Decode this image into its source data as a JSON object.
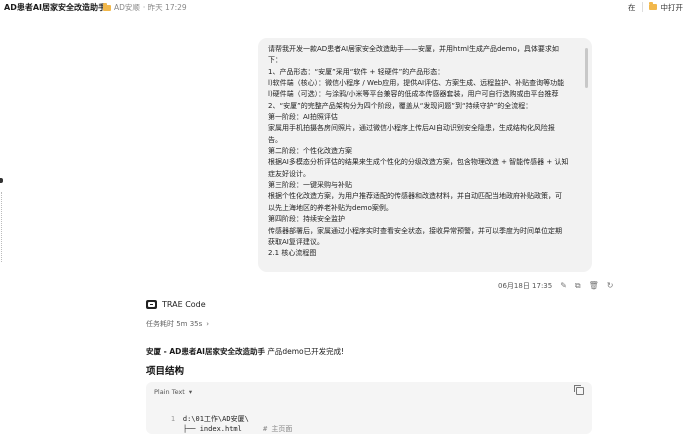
{
  "header": {
    "title": "AD患者AI居家安全改造助手",
    "folder": "AD安顺",
    "time": "· 昨天 17:29",
    "right_label": "在",
    "open_label": "中打开"
  },
  "message": {
    "lines": [
      "请帮我开发一款AD患者AI居家安全改造助手——安厦，并用html生成产品demo，具体要求如",
      "下：",
      "1、产品形态：“安厦”采用“软件 + 轻硬件”的产品形态：",
      "l)软件端（核心）：微信小程序 / Web应用，提供AI评估、方案生成、远程监护、补贴查询等功能",
      "l)硬件端（可选）：与涂鸦/小米等平台兼容的低成本传感器套装，用户可自行选购或由平台推荐",
      "2、“安厦”的完整产品架构分为四个阶段，覆盖从“发现问题”到“持续守护”的全流程：",
      "第一阶段：AI拍照评估",
      "家属用手机拍摄各房间照片，通过微信小程序上传后AI自动识别安全隐患，生成结构化风险报",
      "告。",
      "第二阶段：个性化改造方案",
      "根据AI多模态分析评估的结果来生成个性化的分级改造方案，包含物理改造 + 智能传感器 + 认知",
      "症友好设计。",
      "第三阶段：一键采购与补贴",
      "根据个性化改造方案，为用户推荐适配的传感器和改造材料，并自动匹配当地政府补贴政策，可",
      "以先上海地区的养老补贴为demo案例。",
      "第四阶段：持续安全监护",
      "传感器部署后，家属通过小程序实时查看安全状态，接收异常预警，并可以季度为时间单位定期",
      "获取AI复评建议。",
      "2.1 核心流程图"
    ],
    "timestamp": "06月18日 17:35"
  },
  "agent": {
    "name": "TRAE Code",
    "elapsed": "任务耗时 5m 35s",
    "summary_bold": "安厦 - AD患者AI居家安全改造助手",
    "summary_rest": " 产品demo已开发完成!",
    "section_title": "项目结构"
  },
  "code": {
    "language": "Plain Text",
    "lines": [
      {
        "num": "1",
        "text": "d:\\01工作\\AD安厦\\",
        "comment": ""
      },
      {
        "num": "",
        "text": "├── index.html",
        "comment": "# 主页面"
      }
    ]
  },
  "icons": [
    "folder-icon",
    "chevron-icon",
    "copy-icon",
    "edit-icon",
    "delete-icon",
    "retry-icon",
    "clock-icon",
    "trae-logo"
  ]
}
